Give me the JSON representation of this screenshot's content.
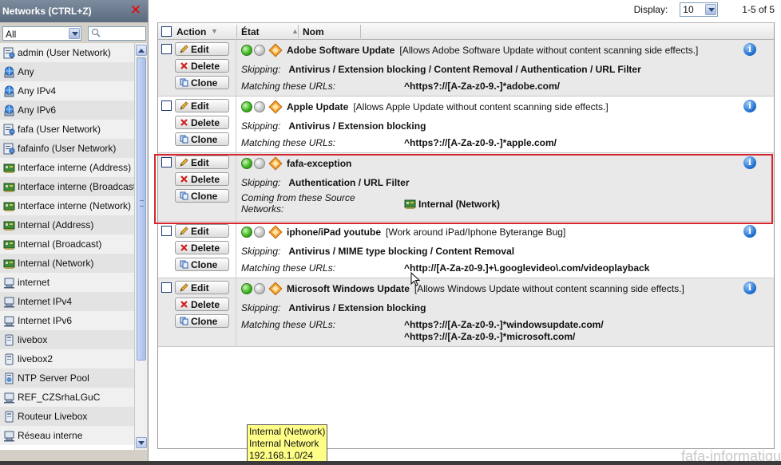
{
  "networks_panel": {
    "title": "Networks (CTRL+Z)",
    "close_glyph": "✕",
    "filter_value": "All",
    "items": [
      {
        "label": "admin (User Network)",
        "icon": "user-network-icon"
      },
      {
        "label": "Any",
        "icon": "globe-icon"
      },
      {
        "label": "Any IPv4",
        "icon": "globe-icon"
      },
      {
        "label": "Any IPv6",
        "icon": "globe-icon"
      },
      {
        "label": "fafa (User Network)",
        "icon": "user-network-icon"
      },
      {
        "label": "fafainfo (User Network)",
        "icon": "user-network-icon"
      },
      {
        "label": "Interface interne (Address)",
        "icon": "interface-card-icon"
      },
      {
        "label": "Interface interne (Broadcast)",
        "icon": "interface-card-icon"
      },
      {
        "label": "Interface interne (Network)",
        "icon": "interface-card-icon"
      },
      {
        "label": "Internal (Address)",
        "icon": "interface-card-icon"
      },
      {
        "label": "Internal (Broadcast)",
        "icon": "interface-card-icon"
      },
      {
        "label": "Internal (Network)",
        "icon": "interface-card-icon"
      },
      {
        "label": "internet",
        "icon": "computer-icon"
      },
      {
        "label": "Internet IPv4",
        "icon": "computer-icon"
      },
      {
        "label": "Internet IPv6",
        "icon": "computer-icon"
      },
      {
        "label": "livebox",
        "icon": "device-icon"
      },
      {
        "label": "livebox2",
        "icon": "device-icon"
      },
      {
        "label": "NTP Server Pool",
        "icon": "server-icon"
      },
      {
        "label": "REF_CZSrhaLGuC",
        "icon": "computer-icon"
      },
      {
        "label": "Routeur Livebox",
        "icon": "device-icon"
      },
      {
        "label": "Réseau interne",
        "icon": "computer-icon"
      }
    ]
  },
  "pager": {
    "display_label": "Display:",
    "display_value": "10",
    "range": "1-5 of 5"
  },
  "table_header": {
    "action": "Action",
    "state": "État",
    "name": "Nom"
  },
  "buttons": {
    "edit": "Edit",
    "delete": "Delete",
    "clone": "Clone"
  },
  "rules": [
    {
      "name": "Adobe Software Update",
      "description": "[Allows Adobe Software Update without content scanning side effects.]",
      "skipping_label": "Skipping:",
      "skipping": "Antivirus / Extension blocking / Content Removal / Authentication / URL Filter",
      "match_label": "Matching these URLs:",
      "urls": [
        "^https?://[A-Za-z0-9.-]*adobe.com/"
      ]
    },
    {
      "name": "Apple Update",
      "description": "[Allows Apple Update without content scanning side effects.]",
      "skipping_label": "Skipping:",
      "skipping": "Antivirus / Extension blocking",
      "match_label": "Matching these URLs:",
      "urls": [
        "^https?://[A-Za-z0-9.-]*apple.com/"
      ]
    },
    {
      "name": "fafa-exception",
      "description": "",
      "skipping_label": "Skipping:",
      "skipping": "Authentication / URL Filter",
      "source_label": "Coming from these Source Networks:",
      "source_network": "Internal (Network)"
    },
    {
      "name": "iphone/iPad youtube",
      "description": "[Work around iPad/Iphone Byterange Bug]",
      "skipping_label": "Skipping:",
      "skipping": "Antivirus / MIME type blocking / Content Removal",
      "match_label": "Matching these URLs:",
      "urls": [
        "^http://[A-Za-z0-9.]+\\.googlevideo\\.com/videoplayback"
      ]
    },
    {
      "name": "Microsoft Windows Update",
      "description": "[Allows Windows Update without content scanning side effects.]",
      "skipping_label": "Skipping:",
      "skipping": "Antivirus / Extension blocking",
      "match_label": "Matching these URLs:",
      "urls": [
        "^https?://[A-Za-z0-9.-]*windowsupdate.com/",
        "^https?://[A-Za-z0-9.-]*microsoft.com/"
      ]
    }
  ],
  "tooltip": {
    "line1": "Internal (Network)",
    "line2": "Internal Network",
    "line3": "192.168.1.0/24"
  },
  "watermark": "fafa-informatiqu",
  "colors": {
    "highlight_border": "#d6262f",
    "header_gradient_top": "#7c8b9d",
    "tooltip_bg": "#ffff88"
  }
}
